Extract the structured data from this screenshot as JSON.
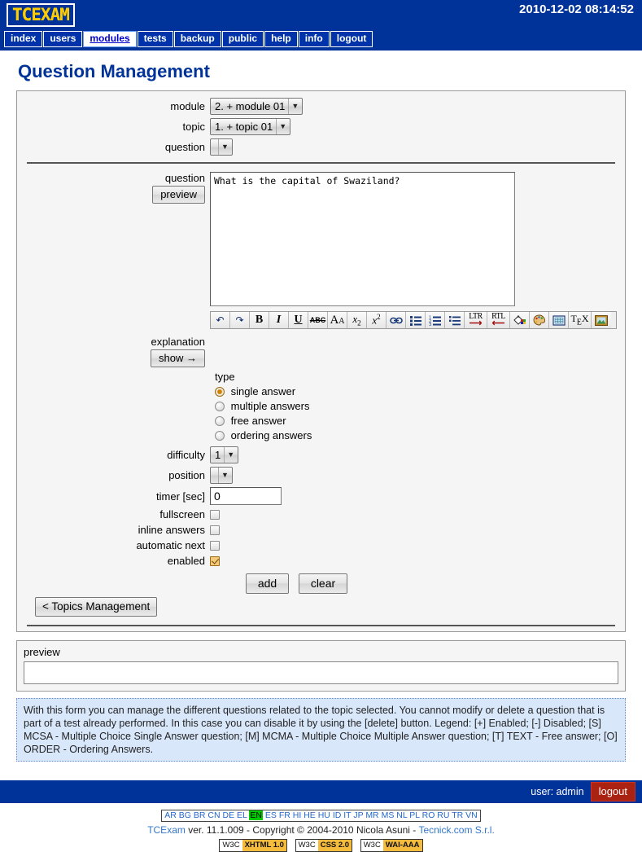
{
  "header": {
    "logo": "TCEXAM",
    "datetime": "2010-12-02 08:14:52"
  },
  "nav": {
    "items": [
      {
        "label": "index",
        "active": false
      },
      {
        "label": "users",
        "active": false
      },
      {
        "label": "modules",
        "active": true
      },
      {
        "label": "tests",
        "active": false
      },
      {
        "label": "backup",
        "active": false
      },
      {
        "label": "public",
        "active": false
      },
      {
        "label": "help",
        "active": false
      },
      {
        "label": "info",
        "active": false
      },
      {
        "label": "logout",
        "active": false
      }
    ]
  },
  "page": {
    "title": "Question Management"
  },
  "form": {
    "module_label": "module",
    "module_value": "2. + module 01",
    "topic_label": "topic",
    "topic_value": "1. + topic 01",
    "question_label": "question",
    "question_value": "",
    "question_text_label": "question",
    "question_preview_btn": "preview",
    "question_text": "What is the capital of Swaziland?",
    "explanation_label": "explanation",
    "explanation_show_btn": "show →",
    "type_label": "type",
    "type_options": [
      {
        "label": "single answer",
        "selected": true
      },
      {
        "label": "multiple answers",
        "selected": false
      },
      {
        "label": "free answer",
        "selected": false
      },
      {
        "label": "ordering answers",
        "selected": false
      }
    ],
    "difficulty_label": "difficulty",
    "difficulty_value": "1",
    "position_label": "position",
    "position_value": "",
    "timer_label": "timer [sec]",
    "timer_value": "0",
    "fullscreen_label": "fullscreen",
    "fullscreen_checked": false,
    "inline_answers_label": "inline answers",
    "inline_answers_checked": false,
    "automatic_next_label": "automatic next",
    "automatic_next_checked": false,
    "enabled_label": "enabled",
    "enabled_checked": true,
    "add_btn": "add",
    "clear_btn": "clear",
    "topics_btn": "< Topics Management"
  },
  "editor_toolbar": {
    "buttons": [
      {
        "name": "undo-icon",
        "glyph": "↶"
      },
      {
        "name": "redo-icon",
        "glyph": "↷"
      },
      {
        "name": "bold-icon",
        "glyph": "B"
      },
      {
        "name": "italic-icon",
        "glyph": "I"
      },
      {
        "name": "underline-icon",
        "glyph": "U"
      },
      {
        "name": "strikethrough-icon",
        "glyph": "ABC"
      },
      {
        "name": "font-size-icon",
        "glyph": "AA"
      },
      {
        "name": "subscript-icon",
        "glyph": "x2"
      },
      {
        "name": "superscript-icon",
        "glyph": "x2"
      },
      {
        "name": "link-icon",
        "glyph": "∞"
      },
      {
        "name": "unordered-list-icon",
        "glyph": "list"
      },
      {
        "name": "ordered-list-icon",
        "glyph": "123"
      },
      {
        "name": "indent-list-icon",
        "glyph": "indent"
      },
      {
        "name": "ltr-direction-icon",
        "glyph": "LTR"
      },
      {
        "name": "rtl-direction-icon",
        "glyph": "RTL"
      },
      {
        "name": "fill-color-icon",
        "glyph": "bucket"
      },
      {
        "name": "palette-icon",
        "glyph": "palette"
      },
      {
        "name": "table-icon",
        "glyph": "table"
      },
      {
        "name": "tex-icon",
        "glyph": "TeX"
      },
      {
        "name": "insert-image-icon",
        "glyph": "image"
      }
    ]
  },
  "preview": {
    "label": "preview",
    "content": ""
  },
  "help": {
    "text": "With this form you can manage the different questions related to the topic selected. You cannot modify or delete a question that is part of a test already performed. In this case you can disable it by using the [delete] button. Legend: [+] Enabled; [-] Disabled; [S] MCSA - Multiple Choice Single Answer question; [M] MCMA - Multiple Choice Multiple Answer question; [T] TEXT - Free answer; [O] ORDER - Ordering Answers."
  },
  "footer": {
    "user_text": "user: admin",
    "logout_label": "logout",
    "languages": [
      "AR",
      "BG",
      "BR",
      "CN",
      "DE",
      "EL",
      "EN",
      "ES",
      "FR",
      "HI",
      "HE",
      "HU",
      "ID",
      "IT",
      "JP",
      "MR",
      "MS",
      "NL",
      "PL",
      "RO",
      "RU",
      "TR",
      "VN"
    ],
    "current_language": "EN",
    "copyright_app": "TCExam",
    "copyright_mid": " ver. 11.1.009 - Copyright © 2004-2010 Nicola Asuni - ",
    "copyright_company": "Tecnick.com S.r.l.",
    "badges": [
      {
        "left": "W3C",
        "right": "XHTML 1.0"
      },
      {
        "left": "W3C",
        "right": "CSS 2.0"
      },
      {
        "left": "W3C",
        "right": "WAI-AAA"
      }
    ]
  },
  "colors": {
    "brand_blue": "#003399",
    "logo_yellow": "#ffcc00",
    "accent_orange": "#e08800",
    "help_bg": "#d9e7fb",
    "logout_red": "#aa2211"
  }
}
